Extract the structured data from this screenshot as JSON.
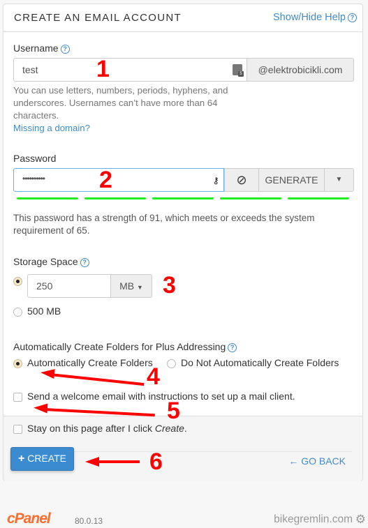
{
  "header": {
    "title": "CREATE AN EMAIL ACCOUNT",
    "help_link": "Show/Hide Help"
  },
  "username": {
    "label": "Username",
    "value": "test",
    "domain": "@elektrobicikli.com",
    "help_text": "You can use letters, numbers, periods, hyphens, and underscores. Usernames can’t have more than 64 characters.",
    "missing_domain_link": "Missing a domain?"
  },
  "password": {
    "label": "Password",
    "value": "••••••••••",
    "generate_label": "GENERATE",
    "strength_value": 91,
    "strength_required": 65,
    "strength_text": "This password has a strength of 91, which meets or exceeds the system requirement of 65."
  },
  "storage": {
    "label": "Storage Space",
    "value": "250",
    "unit": "MB",
    "option2": "500 MB",
    "selected": "custom"
  },
  "plus_addressing": {
    "label": "Automatically Create Folders for Plus Addressing",
    "option1": "Automatically Create Folders",
    "option2": "Do Not Automatically Create Folders",
    "selected": "option1"
  },
  "welcome_email": {
    "label": "Send a welcome email with instructions to set up a mail client.",
    "checked": false
  },
  "stay_on_page": {
    "label_prefix": "Stay on this page after I click ",
    "label_em": "Create",
    "label_suffix": ".",
    "checked": false
  },
  "actions": {
    "create_label": "CREATE",
    "go_back_label": "GO BACK"
  },
  "annotations": [
    "1",
    "2",
    "3",
    "4",
    "5",
    "6"
  ],
  "footer": {
    "brand": "cPanel",
    "version": "80.0.13",
    "watermark": "bikegremlin.com"
  },
  "colors": {
    "accent": "#428bca",
    "primary_button": "#3b8bd0",
    "strength_bar": "#22ee22",
    "annotation": "#ff0000",
    "cpanel_orange": "#ff6c2c"
  }
}
